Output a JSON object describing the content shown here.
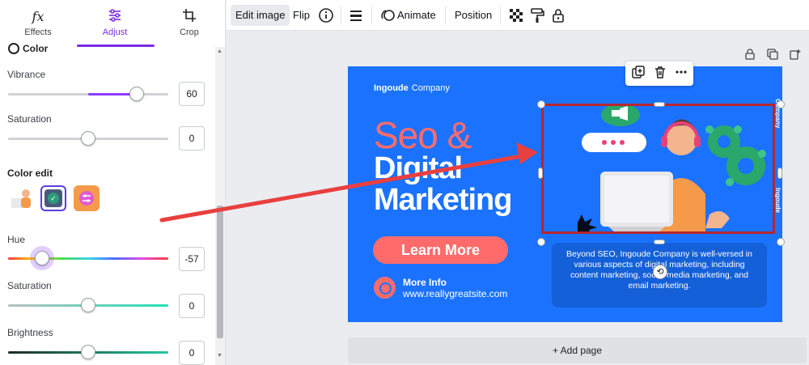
{
  "left_panel": {
    "tabs": [
      {
        "label": "Effects",
        "icon": "fx-icon"
      },
      {
        "label": "Adjust",
        "icon": "sliders-icon"
      },
      {
        "label": "Crop",
        "icon": "crop-icon"
      }
    ],
    "section_title": "Color",
    "sliders_top": [
      {
        "label": "Vibrance",
        "value": "60",
        "fraction": 0.8
      },
      {
        "label": "Saturation",
        "value": "0",
        "fraction": 0.5
      }
    ],
    "color_edit_label": "Color edit",
    "sliders_bottom": [
      {
        "label": "Hue",
        "value": "-57",
        "fraction": 0.21
      },
      {
        "label": "Saturation",
        "value": "0",
        "fraction": 0.5
      },
      {
        "label": "Brightness",
        "value": "0",
        "fraction": 0.5
      }
    ]
  },
  "toolbar": {
    "edit_image": "Edit image",
    "flip": "Flip",
    "animate": "Animate",
    "position": "Position"
  },
  "slide": {
    "brand_bold": "Ingoude",
    "brand_rest": "Company",
    "headline_1": "Seo &",
    "headline_2": "Digital",
    "headline_3": "Marketing",
    "cta": "Learn More",
    "more_info": "More Info",
    "site": "www.reallygreatsite.com",
    "description": "Beyond SEO, Ingoude Company is well-versed in various aspects of digital marketing, including content marketing, social media marketing, and email marketing.",
    "side_text_1": "Company",
    "side_text_2": "Ingoude"
  },
  "add_page": "+ Add page",
  "colors": {
    "accent": "#8b3dff",
    "slide_bg": "#1b72ff",
    "coral": "#ff6b6b",
    "selection": "#b7262d",
    "annotation_arrow": "#e8403f"
  }
}
